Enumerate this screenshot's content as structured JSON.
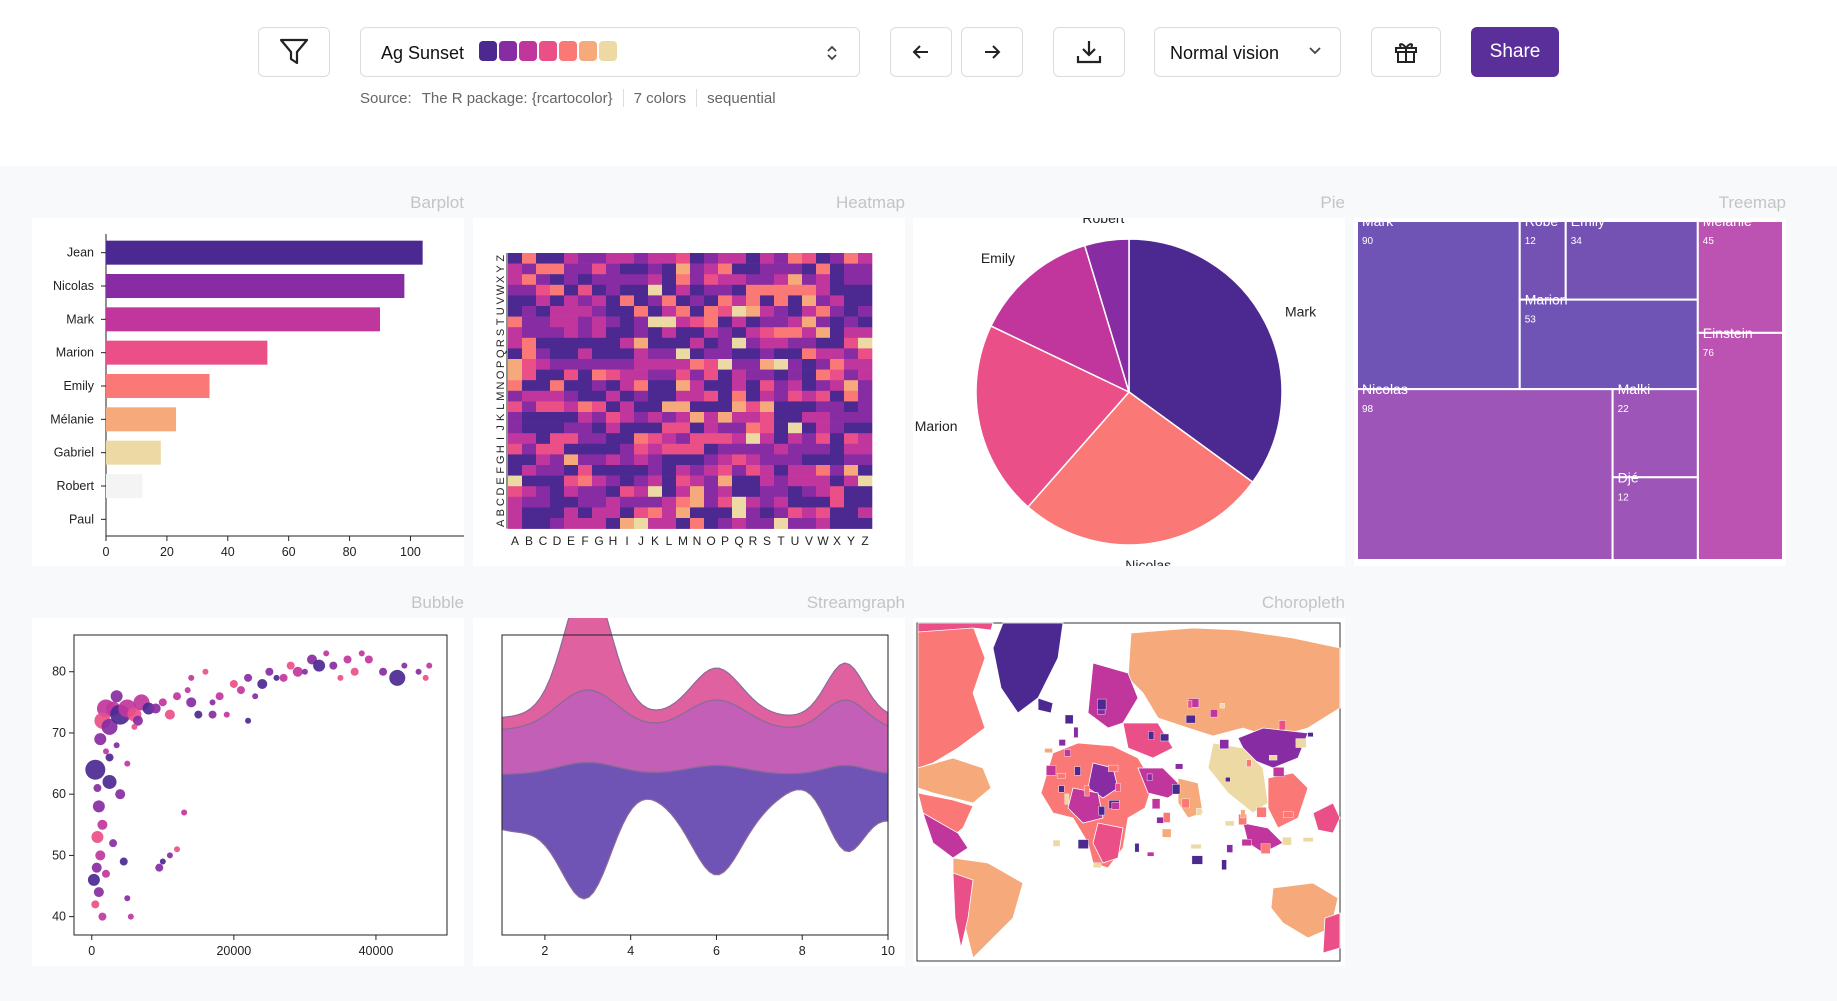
{
  "toolbar": {
    "palette_name": "Ag Sunset",
    "swatches": [
      "#4b2991",
      "#872ca2",
      "#c0369d",
      "#ea4f88",
      "#fa7876",
      "#f6a97a",
      "#edd9a3"
    ],
    "source_label": "Source:",
    "source_value": "The R package: {rcartocolor}",
    "color_count": "7 colors",
    "palette_type": "sequential",
    "vision_label": "Normal vision",
    "share_label": "Share",
    "icons": [
      "filter-icon",
      "updown-icon",
      "arrow-left-icon",
      "arrow-right-icon",
      "download-icon",
      "chevron-down-icon",
      "gift-icon"
    ],
    "accent": "#5a2f9a"
  },
  "panels": {
    "barplot": "Barplot",
    "heatmap": "Heatmap",
    "pie": "Pie",
    "treemap": "Treemap",
    "bubble": "Bubble",
    "streamgraph": "Streamgraph",
    "choropleth": "Choropleth"
  },
  "chart_data": [
    {
      "type": "bar",
      "panel": "Barplot",
      "orientation": "horizontal",
      "categories": [
        "Jean",
        "Nicolas",
        "Mark",
        "Marion",
        "Emily",
        "Mélanie",
        "Gabriel",
        "Robert",
        "Paul"
      ],
      "values": [
        104,
        98,
        90,
        53,
        34,
        23,
        18,
        12,
        0
      ],
      "colors": [
        "#4b2991",
        "#872ca2",
        "#c0369d",
        "#ea4f88",
        "#fa7876",
        "#f6a97a",
        "#edd9a3",
        "#f4f4f4",
        "#ffffff"
      ],
      "xticks": [
        "0",
        "20",
        "40",
        "60",
        "80",
        "100"
      ],
      "xlim": [
        0,
        112
      ]
    },
    {
      "type": "heatmap",
      "panel": "Heatmap",
      "x_labels": [
        "A",
        "B",
        "C",
        "D",
        "E",
        "F",
        "G",
        "H",
        "I",
        "J",
        "K",
        "L",
        "M",
        "N",
        "O",
        "P",
        "Q",
        "R",
        "S",
        "T",
        "U",
        "V",
        "W",
        "X",
        "Y",
        "Z"
      ],
      "y_labels": [
        "A",
        "B",
        "C",
        "D",
        "E",
        "F",
        "G",
        "H",
        "I",
        "J",
        "K",
        "L",
        "M",
        "N",
        "O",
        "P",
        "Q",
        "R",
        "S",
        "T",
        "U",
        "V",
        "W",
        "X",
        "Y",
        "Z"
      ],
      "color_scale": [
        "#4b2991",
        "#872ca2",
        "#c0369d",
        "#ea4f88",
        "#fa7876",
        "#f6a97a",
        "#edd9a3"
      ]
    },
    {
      "type": "pie",
      "panel": "Pie",
      "labels": [
        "Mark",
        "Nicolas",
        "Marion",
        "Emily",
        "Robert"
      ],
      "values": [
        90,
        68,
        53,
        34,
        12
      ],
      "colors": [
        "#4b2991",
        "#fa7876",
        "#ea4f88",
        "#c0369d",
        "#872ca2"
      ]
    },
    {
      "type": "treemap",
      "panel": "Treemap",
      "nodes": [
        {
          "name": "Mark",
          "value": 90
        },
        {
          "name": "Robert",
          "label": "Robe",
          "value": 12
        },
        {
          "name": "Emily",
          "value": 34
        },
        {
          "name": "Marion",
          "value": 53
        },
        {
          "name": "Mélanie",
          "value": 45
        },
        {
          "name": "Einstein",
          "value": 76
        },
        {
          "name": "Nicolas",
          "value": 98
        },
        {
          "name": "Malki",
          "value": 22
        },
        {
          "name": "Djé",
          "value": 12
        }
      ]
    },
    {
      "type": "scatter",
      "panel": "Bubble",
      "xticks": [
        "0",
        "20000",
        "40000"
      ],
      "yticks": [
        "40",
        "50",
        "60",
        "70",
        "80"
      ],
      "xlim": [
        -2500,
        50000
      ],
      "ylim": [
        37,
        86
      ],
      "points": [
        [
          500,
          64,
          10
        ],
        [
          1200,
          69,
          6
        ],
        [
          2000,
          74,
          9
        ],
        [
          1500,
          72,
          8
        ],
        [
          3000,
          74,
          7
        ],
        [
          2500,
          71,
          8
        ],
        [
          4000,
          73,
          10
        ],
        [
          3500,
          76,
          6
        ],
        [
          5000,
          74,
          9
        ],
        [
          6000,
          73,
          7
        ],
        [
          7000,
          75,
          8
        ],
        [
          6500,
          72,
          5
        ],
        [
          8000,
          74,
          6
        ],
        [
          9000,
          74,
          5
        ],
        [
          10000,
          75,
          4
        ],
        [
          11000,
          73,
          5
        ],
        [
          12000,
          76,
          4
        ],
        [
          14000,
          75,
          5
        ],
        [
          15000,
          73,
          4
        ],
        [
          17000,
          73,
          4
        ],
        [
          18000,
          76,
          4
        ],
        [
          20000,
          78,
          4
        ],
        [
          21000,
          77,
          4
        ],
        [
          22000,
          79,
          4
        ],
        [
          24000,
          78,
          5
        ],
        [
          25000,
          80,
          4
        ],
        [
          27000,
          79,
          4
        ],
        [
          28000,
          81,
          4
        ],
        [
          29000,
          80,
          5
        ],
        [
          31000,
          82,
          5
        ],
        [
          32000,
          81,
          6
        ],
        [
          34000,
          81,
          4
        ],
        [
          36000,
          82,
          4
        ],
        [
          37000,
          80,
          4
        ],
        [
          39000,
          82,
          4
        ],
        [
          41000,
          80,
          4
        ],
        [
          43000,
          79,
          8
        ],
        [
          46000,
          80,
          3
        ],
        [
          47500,
          81,
          3
        ],
        [
          47000,
          79,
          3
        ],
        [
          5000,
          65,
          3
        ],
        [
          4000,
          60,
          5
        ],
        [
          2500,
          62,
          7
        ],
        [
          1000,
          58,
          6
        ],
        [
          1500,
          55,
          5
        ],
        [
          800,
          53,
          6
        ],
        [
          1200,
          50,
          5
        ],
        [
          700,
          48,
          5
        ],
        [
          300,
          46,
          6
        ],
        [
          1000,
          44,
          5
        ],
        [
          2000,
          47,
          4
        ],
        [
          500,
          42,
          4
        ],
        [
          1500,
          40,
          4
        ],
        [
          3000,
          52,
          4
        ],
        [
          4500,
          49,
          4
        ],
        [
          5000,
          43,
          3
        ],
        [
          5500,
          40,
          3
        ],
        [
          12000,
          51,
          3
        ],
        [
          13000,
          57,
          3
        ],
        [
          11000,
          50,
          3
        ],
        [
          10000,
          49,
          3
        ],
        [
          9500,
          48,
          4
        ],
        [
          14000,
          79,
          3
        ],
        [
          16000,
          80,
          3
        ],
        [
          19000,
          73,
          3
        ],
        [
          23000,
          76,
          3
        ],
        [
          26000,
          79,
          3
        ],
        [
          30000,
          80,
          3
        ],
        [
          33000,
          83,
          3
        ],
        [
          35000,
          79,
          3
        ],
        [
          38000,
          83,
          3
        ],
        [
          44000,
          81,
          3
        ],
        [
          22000,
          72,
          3
        ],
        [
          17000,
          75,
          3
        ],
        [
          13500,
          77,
          3
        ],
        [
          6000,
          71,
          3
        ],
        [
          2000,
          67,
          3
        ],
        [
          3500,
          68,
          3
        ],
        [
          2500,
          66,
          4
        ],
        [
          800,
          61,
          4
        ]
      ]
    },
    {
      "type": "area",
      "panel": "Streamgraph",
      "xticks": [
        "2",
        "4",
        "6",
        "8",
        "10"
      ],
      "xlim": [
        1,
        10
      ]
    },
    {
      "type": "choropleth",
      "panel": "Choropleth"
    }
  ]
}
